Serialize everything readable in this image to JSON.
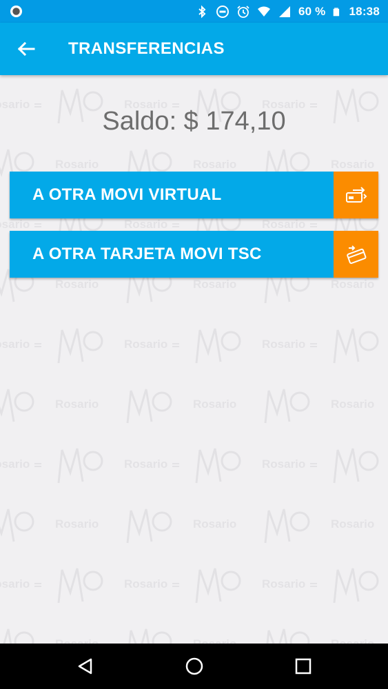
{
  "status_bar": {
    "battery_text": "60 %",
    "time": "18:38",
    "icons": [
      "circle-app-icon",
      "bluetooth-icon",
      "do-not-disturb-icon",
      "alarm-icon",
      "wifi-icon",
      "signal-icon",
      "battery-icon"
    ]
  },
  "app_bar": {
    "title": "TRANSFERENCIAS",
    "back_icon": "arrow-left-icon"
  },
  "balance": {
    "text": "Saldo: $ 174,10"
  },
  "actions": [
    {
      "label": "A OTRA MOVI VIRTUAL",
      "icon": "virtual-card-transfer-icon"
    },
    {
      "label": "A OTRA TARJETA MOVI TSC",
      "icon": "card-transfer-icon"
    }
  ],
  "watermark": {
    "text": "Rosario",
    "logo": "MOVI"
  },
  "nav": {
    "icons": [
      "back-triangle-icon",
      "home-circle-icon",
      "recents-square-icon"
    ]
  },
  "colors": {
    "status_bar": "#039be5",
    "app_bar": "#03a9e8",
    "action_bg": "#03a9e8",
    "action_icon_bg": "#fb8c00",
    "background": "#f1f0f2",
    "balance_text": "#6d6d6d"
  }
}
